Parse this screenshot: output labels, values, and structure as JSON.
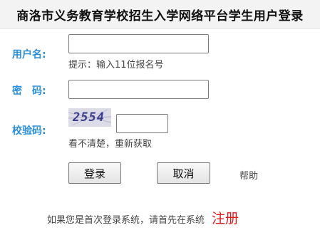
{
  "header": {
    "title": "商洛市义务教育学校招生入学网络平台学生用户登录"
  },
  "form": {
    "username_label": "用户名:",
    "username_value": "",
    "username_hint": "提示：输入11位报名号",
    "password_label": "密　码:",
    "password_value": "",
    "captcha_label": "校验码:",
    "captcha_image_text": "2554",
    "captcha_value": "",
    "captcha_refresh": "看不清楚，重新获取"
  },
  "buttons": {
    "login": "登录",
    "cancel": "取消",
    "help": "帮助"
  },
  "footer": {
    "prompt": "如果您是首次登录系统，请首先在系统",
    "register_link": "注册"
  }
}
